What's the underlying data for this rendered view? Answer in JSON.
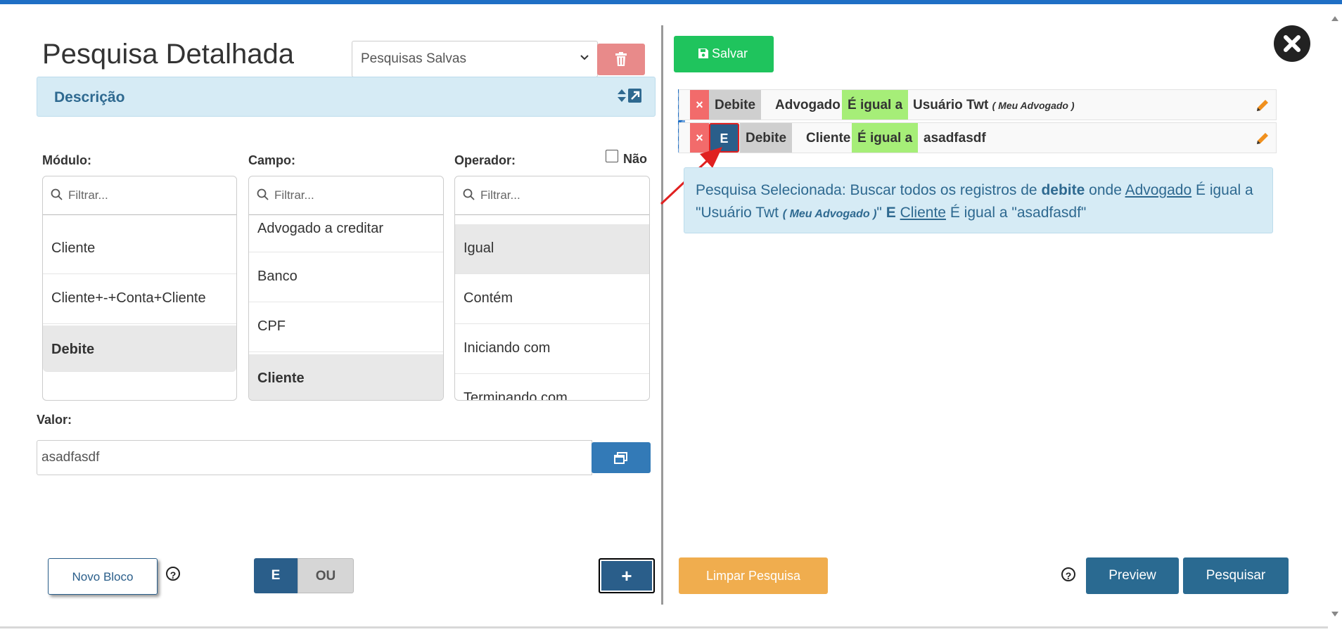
{
  "header": {
    "title": "Pesquisa Detalhada",
    "saved_searches_placeholder": "Pesquisas Salvas"
  },
  "description_bar": {
    "label": "Descrição"
  },
  "columns": {
    "modulo": {
      "label": "Módulo:",
      "filter_placeholder": "Filtrar...",
      "items": [
        "Cliente",
        "Cliente+-+Conta+Cliente",
        "Debite"
      ],
      "selected": "Debite"
    },
    "campo": {
      "label": "Campo:",
      "filter_placeholder": "Filtrar...",
      "items": [
        "Advogado a creditar",
        "Banco",
        "CPF",
        "Cliente"
      ],
      "selected": "Cliente"
    },
    "operador": {
      "label": "Operador:",
      "filter_placeholder": "Filtrar...",
      "items": [
        "Igual",
        "Contém",
        "Iniciando com",
        "Terminando com"
      ],
      "selected": "Igual"
    },
    "nao_label": "Não"
  },
  "valor": {
    "label": "Valor:",
    "value": "asadfasdf"
  },
  "footer_left": {
    "novo_bloco": "Novo Bloco",
    "help": "?",
    "e_label": "E",
    "ou_label": "OU",
    "add_label": "+"
  },
  "right": {
    "salvar": "Salvar",
    "criteria": [
      {
        "remove": "×",
        "module": "Debite",
        "field": "Advogado",
        "operator": "É igual a",
        "value": "Usuário Twt",
        "value_note": "( Meu Advogado )"
      },
      {
        "remove": "×",
        "connector": "E",
        "module": "Debite",
        "field": "Cliente",
        "operator": "É igual a",
        "value": "asadfasdf"
      }
    ],
    "summary": {
      "prefix": "Pesquisa Selecionada: Buscar todos os registros de",
      "module": "debite",
      "onde": "onde",
      "field1": "Advogado",
      "op1": "É igual a",
      "val1": "\"Usuário Twt",
      "val1_note": "( Meu Advogado )",
      "val1_end": "\"",
      "connector": "E",
      "field2": "Cliente",
      "op2": "É igual a",
      "val2": "\"asadfasdf\""
    },
    "limpar": "Limpar Pesquisa",
    "help": "?",
    "preview": "Preview",
    "pesquisar": "Pesquisar"
  },
  "colors": {
    "accent_blue": "#2a5e8a",
    "save_green": "#1fc45d",
    "clear_orange": "#f0ad4e",
    "remove_red": "#f26b6b",
    "operator_green": "#a6ee78",
    "info_bg": "#d6ebf5"
  }
}
